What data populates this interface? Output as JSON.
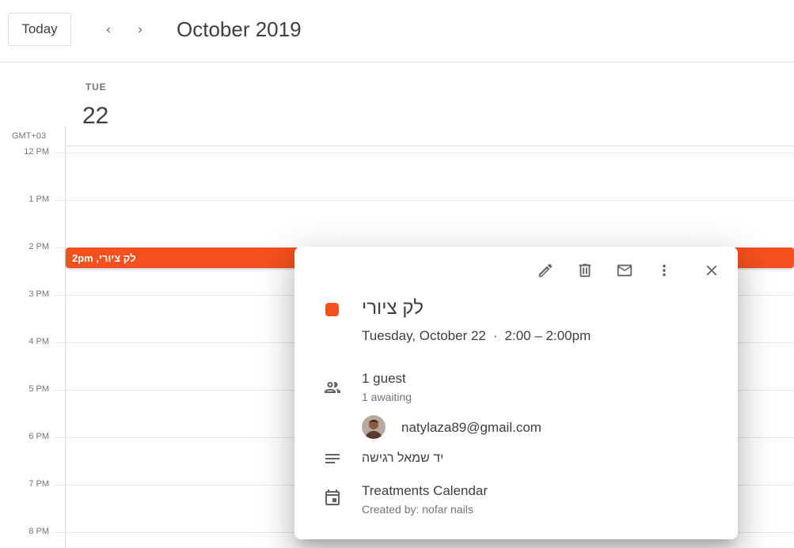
{
  "header": {
    "today_label": "Today",
    "month_title": "October 2019"
  },
  "day": {
    "weekday": "TUE",
    "date": "22",
    "timezone": "GMT+03"
  },
  "hours": [
    "12 PM",
    "1 PM",
    "2 PM",
    "3 PM",
    "4 PM",
    "5 PM",
    "6 PM",
    "7 PM",
    "8 PM"
  ],
  "event_chip": {
    "label": "לק ציורי, 2pm",
    "color": "#f4511e"
  },
  "popover": {
    "title": "לק ציורי",
    "date": "Tuesday, October 22",
    "separator": "·",
    "time": "2:00 – 2:00pm",
    "guests_count": "1 guest",
    "guests_status": "1 awaiting",
    "guest_email": "natylaza89@gmail.com",
    "description": "יד שמאל רגישה",
    "calendar_name": "Treatments Calendar",
    "created_by": "Created by: nofar nails",
    "color": "#f4511e"
  }
}
